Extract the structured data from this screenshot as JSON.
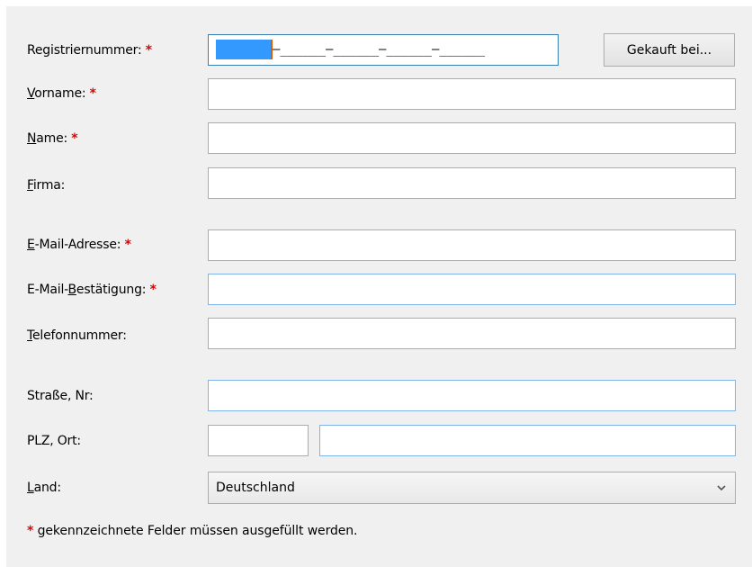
{
  "form": {
    "registration": {
      "label": "Registriernummer:",
      "required_marker": "*",
      "mask": "–______–______–______–______",
      "bought_button": "Gekauft bei..."
    },
    "first_name": {
      "label_ul": "V",
      "label_rest": "orname:",
      "required_marker": "*",
      "value": ""
    },
    "last_name": {
      "label_ul": "N",
      "label_rest": "ame:",
      "required_marker": "*",
      "value": ""
    },
    "company": {
      "label_ul": "F",
      "label_rest": "irma:",
      "value": ""
    },
    "email": {
      "label_ul": "E",
      "label_rest": "-Mail-Adresse:",
      "required_marker": "*",
      "value": ""
    },
    "email_confirm": {
      "label_pre": "E-Mail-",
      "label_ul": "B",
      "label_rest": "estätigung:",
      "required_marker": "*",
      "value": ""
    },
    "phone": {
      "label_ul": "T",
      "label_rest": "elefonnummer:",
      "value": ""
    },
    "street": {
      "label": "Straße, Nr:",
      "value": ""
    },
    "zip_city": {
      "label": "PLZ, Ort:",
      "zip_value": "",
      "city_value": ""
    },
    "country": {
      "label_ul": "L",
      "label_rest": "and:",
      "selected": "Deutschland"
    },
    "footnote": {
      "marker": "*",
      "text": " gekennzeichnete Felder müssen ausgefüllt werden."
    }
  },
  "colors": {
    "panel_bg": "#f0f0f0",
    "required": "#e00000",
    "selection": "#3399ff",
    "focus_border": "#7eb4ea"
  }
}
